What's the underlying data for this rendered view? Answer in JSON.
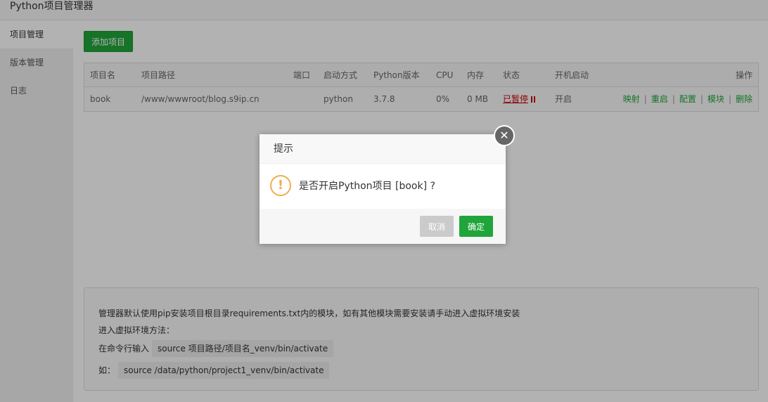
{
  "window": {
    "title": "Python项目管理器"
  },
  "sidebar": {
    "items": [
      {
        "label": "项目管理",
        "active": true
      },
      {
        "label": "版本管理",
        "active": false
      },
      {
        "label": "日志",
        "active": false
      }
    ]
  },
  "toolbar": {
    "add_label": "添加项目"
  },
  "table": {
    "headers": [
      "项目名",
      "项目路径",
      "端口",
      "启动方式",
      "Python版本",
      "CPU",
      "内存",
      "状态",
      "开机启动",
      "操作"
    ],
    "rows": [
      {
        "name": "book",
        "path": "/www/wwwroot/blog.s9ip.cn",
        "port": "",
        "start_mode": "python",
        "python_version": "3.7.8",
        "cpu": "0%",
        "memory": "0 MB",
        "status": "已暂停",
        "boot": "开启",
        "actions": [
          "映射",
          "重启",
          "配置",
          "模块",
          "删除"
        ],
        "separator": "|"
      }
    ]
  },
  "help": {
    "line1": "管理器默认使用pip安装项目根目录requirements.txt内的模块，如有其他模块需要安装请手动进入虚拟环境安装",
    "line2": "进入虚拟环境方法：",
    "line3_label": "在命令行输入",
    "line3_code": "source 项目路径/项目名_venv/bin/activate",
    "line4_label": "如：",
    "line4_code": "source /data/python/project1_venv/bin/activate"
  },
  "dialog": {
    "title": "提示",
    "message": "是否开启Python项目 [book] ?",
    "icon": "warning-icon",
    "icon_glyph": "!",
    "cancel_label": "取消",
    "ok_label": "确定",
    "close_glyph": "✕"
  },
  "colors": {
    "accent": "#20a53a",
    "status_stopped": "#cc0000",
    "warning": "#f0ad4e"
  }
}
